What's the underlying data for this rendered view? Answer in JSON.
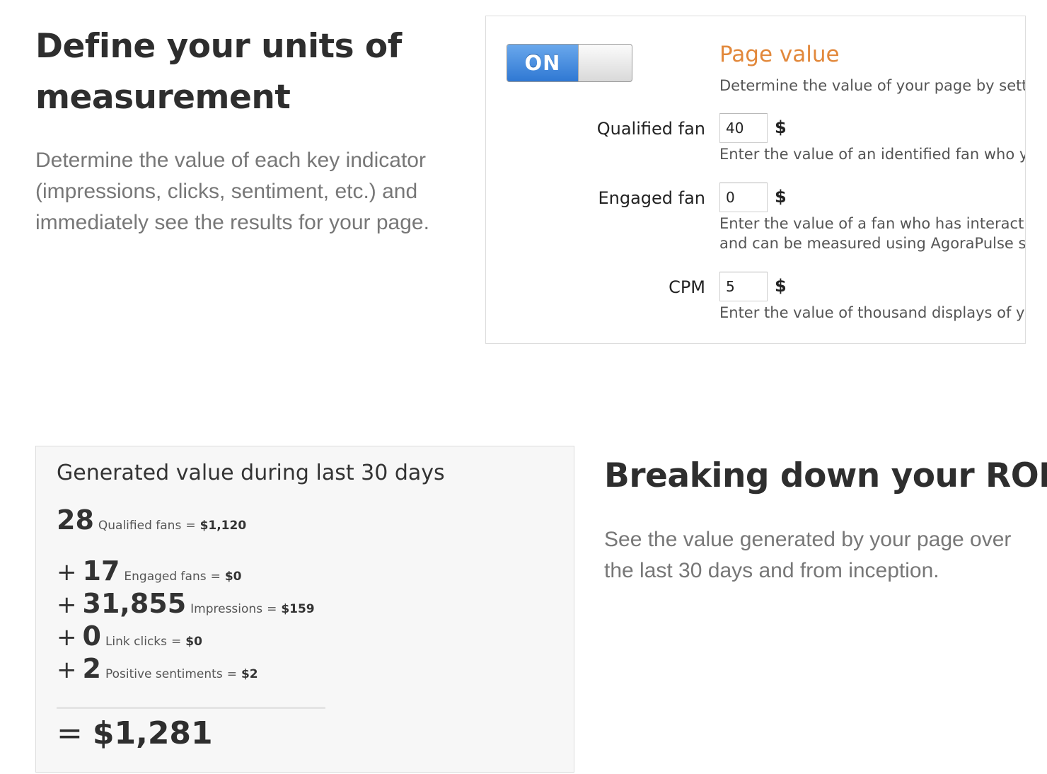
{
  "units": {
    "heading": "Define your units of measurement",
    "description": "Determine the value of each key indicator (impressions, clicks, sentiment, etc.) and immediately see the results for your page."
  },
  "settings": {
    "toggle_label": "ON",
    "toggle_state": "on",
    "title": "Page value",
    "description": "Determine the value of your page by sett",
    "title_color": "#e2883b",
    "toggle_color": "#2f78d3",
    "fields": [
      {
        "label": "Qualified fan",
        "value": "40",
        "currency": "$",
        "help": [
          "Enter the value of an identified fan who y"
        ]
      },
      {
        "label": "Engaged fan",
        "value": "0",
        "currency": "$",
        "help": [
          "Enter the value of a fan who has interact",
          "and can be measured using AgoraPulse s"
        ]
      },
      {
        "label": "CPM",
        "value": "5",
        "currency": "$",
        "help": [
          "Enter the value of thousand displays of y"
        ]
      }
    ]
  },
  "generated": {
    "title": "Generated value during last 30 days",
    "metrics": [
      {
        "prefix": "",
        "count": "28",
        "label": "Qualified fans",
        "equals": "=",
        "value": "$1,120"
      },
      {
        "prefix": "+",
        "count": "17",
        "label": "Engaged fans",
        "equals": "=",
        "value": "$0"
      },
      {
        "prefix": "+",
        "count": "31,855",
        "label": "Impressions",
        "equals": "=",
        "value": "$159"
      },
      {
        "prefix": "+",
        "count": "0",
        "label": "Link clicks",
        "equals": "=",
        "value": "$0"
      },
      {
        "prefix": "+",
        "count": "2",
        "label": "Positive sentiments",
        "equals": "=",
        "value": "$2"
      }
    ],
    "total_equals": "=",
    "total": "$1,281"
  },
  "roi": {
    "heading": "Breaking down your ROI",
    "description": "See the value generated by your page over the last 30 days and from inception."
  }
}
